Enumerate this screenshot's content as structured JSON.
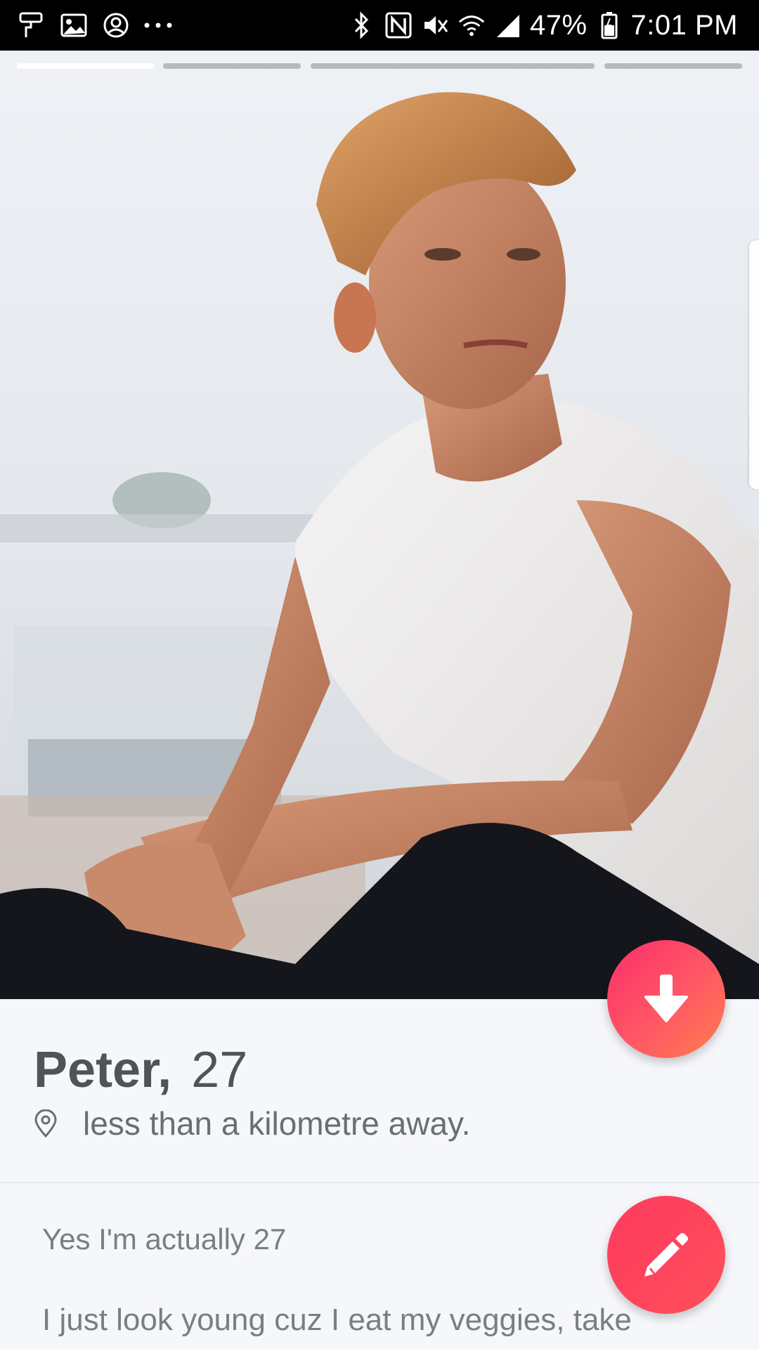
{
  "status_bar": {
    "left_icons": [
      "paint-roller-icon",
      "gallery-icon",
      "account-circle-icon",
      "more-dots-icon"
    ],
    "right_icons": [
      "bluetooth-icon",
      "nfc-icon",
      "mute-icon",
      "wifi-icon",
      "signal-icon",
      "battery-icon"
    ],
    "battery": "47%",
    "time": "7:01 PM"
  },
  "photo": {
    "subject": "profile-photo",
    "indicator_count": 4,
    "active_indicator": 1
  },
  "profile": {
    "name": "Peter,",
    "age": "27",
    "location_icon": "location-pin-icon",
    "distance": "less than a kilometre away."
  },
  "bio": {
    "line1": "Yes I'm actually 27",
    "line2": "I just look young cuz I eat my veggies, take"
  },
  "buttons": {
    "collapse_icon": "arrow-down-icon",
    "edit_icon": "pencil-icon"
  },
  "colors": {
    "accent_start": "#fd2d6b",
    "accent_end": "#ff7d4e",
    "status_bar": "#000000",
    "text_dark": "#505458"
  }
}
